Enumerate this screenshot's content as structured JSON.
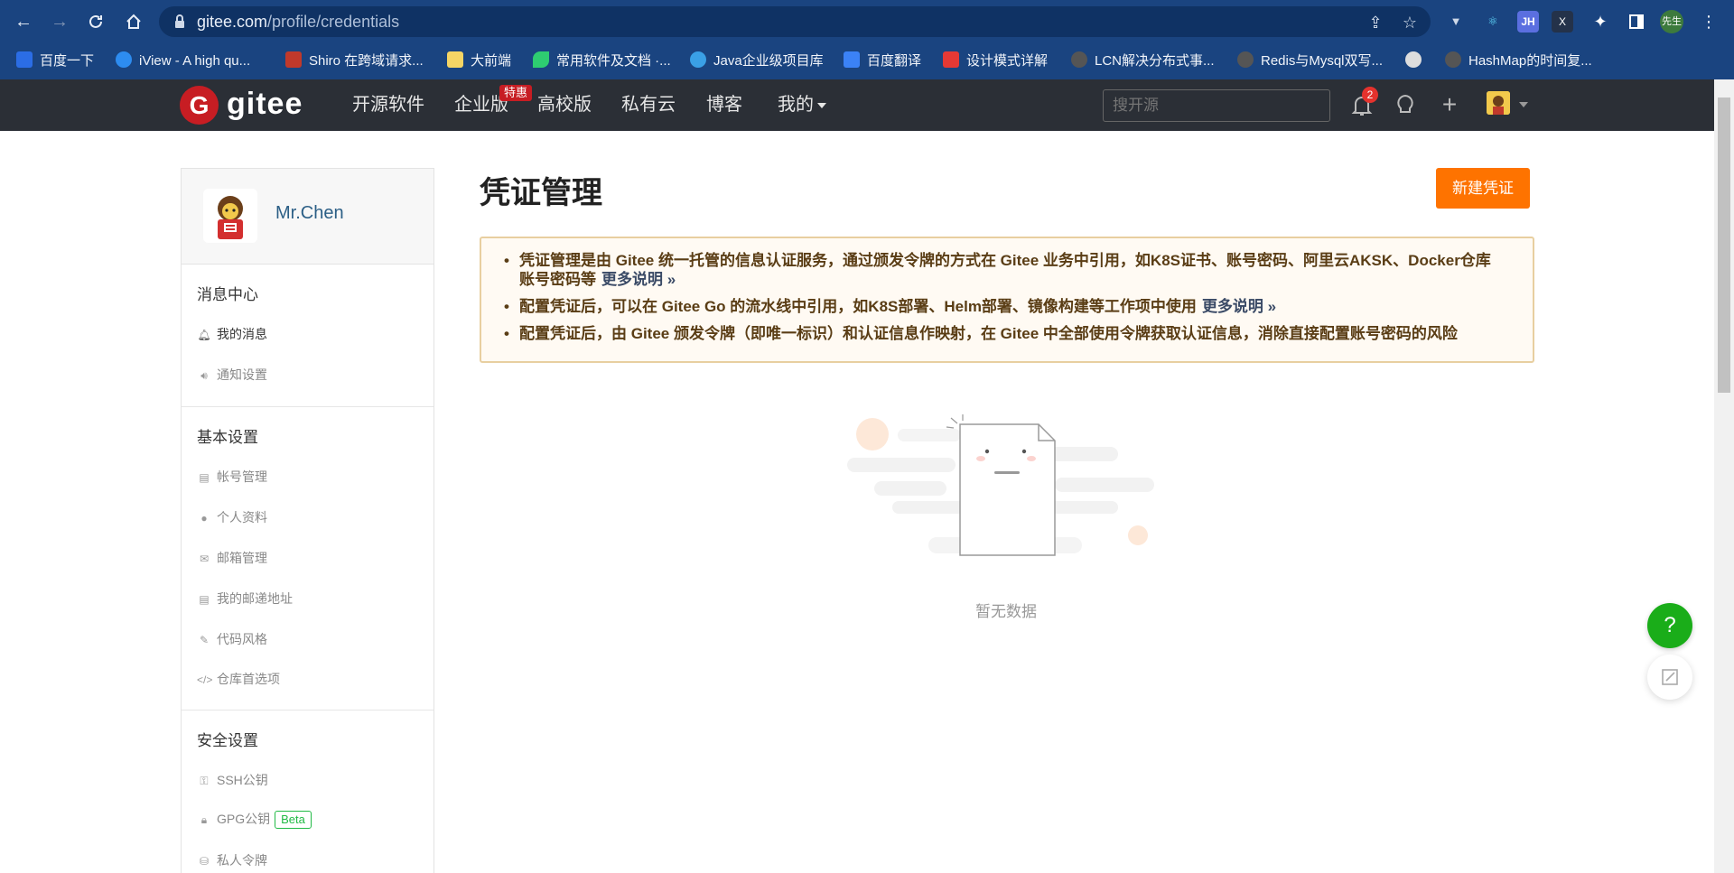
{
  "browser": {
    "url_host": "gitee.com",
    "url_path": "/profile/credentials",
    "profile_label": "先生",
    "ext_jh": "JH",
    "ext_x": "X"
  },
  "bookmarks": [
    {
      "label": "百度一下",
      "color": "#2b6de5"
    },
    {
      "label": "iView - A high qu...",
      "color": "#2d8cf0"
    },
    {
      "label": "Shiro 在跨域请求...",
      "color": "#c0392b"
    },
    {
      "label": "大前端",
      "color": "#f5d565"
    },
    {
      "label": "常用软件及文档 ·...",
      "color": "#2ecc71"
    },
    {
      "label": "Java企业级项目库",
      "color": "#3aa0e6"
    },
    {
      "label": "百度翻译",
      "color": "#3b82f6"
    },
    {
      "label": "设计模式详解",
      "color": "#e53935"
    },
    {
      "label": "LCN解决分布式事...",
      "color": "#555555"
    },
    {
      "label": "Redis与Mysql双写...",
      "color": "#555555"
    },
    {
      "label": "",
      "color": "#dddddd"
    },
    {
      "label": "HashMap的时间复...",
      "color": "#555555"
    }
  ],
  "header": {
    "logo_text": "gitee",
    "logo_letter": "G",
    "nav": [
      "开源软件",
      "企业版",
      "高校版",
      "私有云",
      "博客",
      "我的"
    ],
    "hot_badge": "特惠",
    "search_placeholder": "搜开源",
    "notification_count": "2"
  },
  "sidebar": {
    "user_name": "Mr.Chen",
    "sections": [
      {
        "title": "消息中心",
        "items": [
          {
            "label": "我的消息",
            "icon": "bell-icon",
            "active": true
          },
          {
            "label": "通知设置",
            "icon": "speaker-icon",
            "active": false
          }
        ]
      },
      {
        "title": "基本设置",
        "items": [
          {
            "label": "帐号管理",
            "icon": "id-card-icon"
          },
          {
            "label": "个人资料",
            "icon": "user-icon"
          },
          {
            "label": "邮箱管理",
            "icon": "envelope-icon"
          },
          {
            "label": "我的邮递地址",
            "icon": "address-card-icon"
          },
          {
            "label": "代码风格",
            "icon": "brush-icon"
          },
          {
            "label": "仓库首选项",
            "icon": "code-icon"
          }
        ]
      },
      {
        "title": "安全设置",
        "items": [
          {
            "label": "SSH公钥",
            "icon": "key-icon"
          },
          {
            "label": "GPG公钥",
            "icon": "lock-icon",
            "badge": "Beta"
          },
          {
            "label": "私人令牌",
            "icon": "token-icon"
          }
        ]
      }
    ]
  },
  "main": {
    "title": "凭证管理",
    "new_button": "新建凭证",
    "notices": [
      {
        "text": "凭证管理是由 Gitee 统一托管的信息认证服务，通过颁发令牌的方式在 Gitee 业务中引用，如K8S证书、账号密码、阿里云AKSK、Docker仓库账号密码等",
        "more": "更多说明 »"
      },
      {
        "text": "配置凭证后，可以在 Gitee Go 的流水线中引用，如K8S部署、Helm部署、镜像构建等工作项中使用",
        "more": "更多说明 »"
      },
      {
        "text": "配置凭证后，由 Gitee 颁发令牌（即唯一标识）和认证信息作映射，在 Gitee 中全部使用令牌获取认证信息，消除直接配置账号密码的风险",
        "more": ""
      }
    ],
    "empty_text": "暂无数据"
  },
  "floating": {
    "help_label": "?",
    "edit_label": "✎"
  }
}
